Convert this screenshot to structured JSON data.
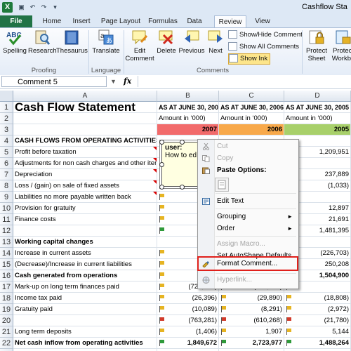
{
  "window": {
    "title": "Cashflow Sta",
    "app_icon": "excel-icon",
    "quick_access": [
      "save-icon",
      "undo-icon",
      "redo-icon",
      "customize-icon"
    ]
  },
  "tabs": [
    "File",
    "Home",
    "Insert",
    "Page Layout",
    "Formulas",
    "Data",
    "Review",
    "View"
  ],
  "active_tab": "Review",
  "ribbon": {
    "proofing": {
      "label": "Proofing",
      "buttons": [
        "Spelling",
        "Research",
        "Thesaurus"
      ]
    },
    "language": {
      "label": "Language",
      "buttons": [
        "Translate"
      ]
    },
    "comments": {
      "label": "Comments",
      "edit": [
        "Edit",
        "Comment"
      ],
      "buttons": [
        "Delete",
        "Previous",
        "Next"
      ],
      "small": [
        "Show/Hide Comment",
        "Show All Comments",
        "Show Ink"
      ]
    },
    "changes": {
      "protect_sheet": [
        "Protect",
        "Sheet"
      ],
      "protect_workbook": [
        "Protect",
        "Workbo"
      ]
    }
  },
  "formula_bar": {
    "name_box": "Comment 5",
    "fx": "fx",
    "value": ""
  },
  "grid": {
    "columns": [
      "A",
      "B",
      "C",
      "D"
    ],
    "rows": [
      {
        "n": "1",
        "a": "Cash Flow Statement",
        "b": "AS AT JUNE 30, 2007",
        "c": "AS AT JUNE 30, 2006",
        "d": "AS AT JUNE 30, 2005"
      },
      {
        "n": "2",
        "a": "",
        "b": "Amount in ‘000)",
        "c": "Amount in ‘000)",
        "d": "Amount in ‘000)"
      },
      {
        "n": "3",
        "a": "",
        "b": "2007",
        "c": "2006",
        "d": "2005"
      },
      {
        "n": "4",
        "a": "CASH FLOWS FROM OPERATING ACTIVITIES",
        "b": "",
        "c": "",
        "d": ""
      },
      {
        "n": "5",
        "a": "Profit before taxation",
        "b": "",
        "c": "",
        "d": "1,209,951"
      },
      {
        "n": "6",
        "a": "Adjustments for non cash charges and other items",
        "b": "",
        "c": "",
        "d": ""
      },
      {
        "n": "7",
        "a": "Depreciation",
        "b": "",
        "c": "",
        "d": "237,889"
      },
      {
        "n": "8",
        "a": "Loss / (gain) on sale of fixed assets",
        "b": "",
        "c": "",
        "d": "(1,033)"
      },
      {
        "n": "9",
        "a": "Liabilities no more payable written back",
        "b": "",
        "c": "",
        "d": ""
      },
      {
        "n": "10",
        "a": "Provision for gratuity",
        "b": "",
        "c": "",
        "d": "12,897"
      },
      {
        "n": "11",
        "a": "Finance costs",
        "b": "",
        "c": "",
        "d": "21,691"
      },
      {
        "n": "12",
        "a": "",
        "b": "4,",
        "c": "",
        "d": "1,481,395"
      },
      {
        "n": "13",
        "a": "Working capital changes",
        "b": "",
        "c": "",
        "d": ""
      },
      {
        "n": "14",
        "a": "Increase in current assets",
        "b": "(1,7",
        "c": "",
        "d": "(226,703)"
      },
      {
        "n": "15",
        "a": "(Decrease)/Increase in current liabilities",
        "b": "(",
        "c": "",
        "d": "250,208"
      },
      {
        "n": "16",
        "a": "Cash generated from operations",
        "b": "2,",
        "c": "",
        "d": "1,504,900"
      },
      {
        "n": "17",
        "a": "Mark-up on long term finances paid",
        "b": "(726,796)",
        "c": "(572,087)",
        "d": ""
      },
      {
        "n": "18",
        "a": "Income tax paid",
        "b": "(26,396)",
        "c": "(29,890)",
        "d": "(18,808)"
      },
      {
        "n": "19",
        "a": "Gratuity paid",
        "b": "(10,089)",
        "c": "(8,291)",
        "d": "(2,972)"
      },
      {
        "n": "20",
        "a": "",
        "b": "(763,281)",
        "c": "(610,268)",
        "d": "(21,780)"
      },
      {
        "n": "21",
        "a": "Long term deposits",
        "b": "(1,406)",
        "c": "1,907",
        "d": "5,144"
      },
      {
        "n": "22",
        "a": "Net cash inflow from operating activities",
        "b": "1,849,672",
        "c": "2,723,977",
        "d": "1,488,264"
      },
      {
        "n": "23",
        "a": "CASH FLOWS FROM INVESTING ACTIVITIES",
        "b": "",
        "c": "",
        "d": ""
      }
    ]
  },
  "comment": {
    "author": "user:",
    "text": "How to ed"
  },
  "context_menu": [
    {
      "label": "Cut",
      "icon": "scissors-icon",
      "disabled": true
    },
    {
      "label": "Copy",
      "icon": "copy-icon",
      "disabled": true
    },
    {
      "label": "Paste Options:",
      "icon": "paste-icon",
      "bold": true
    },
    {
      "label": "",
      "icon": "paste-option-icon"
    },
    {
      "label": "Edit Text",
      "icon": "edit-text-icon"
    },
    {
      "label": "Grouping",
      "submenu": true
    },
    {
      "label": "Order",
      "submenu": true
    },
    {
      "label": "Assign Macro...",
      "disabled": true
    },
    {
      "label": "Set AutoShape Defaults"
    },
    {
      "label": "Format Comment...",
      "icon": "format-comment-icon",
      "highlighted": true
    },
    {
      "label": "Hyperlink...",
      "icon": "hyperlink-icon",
      "disabled": true
    }
  ],
  "colors": {
    "year_2007": "#f26b6b",
    "year_2006": "#f8a94a",
    "year_2005": "#a8d06a",
    "highlight_box": "#e0201b",
    "file_tab": "#217346"
  }
}
